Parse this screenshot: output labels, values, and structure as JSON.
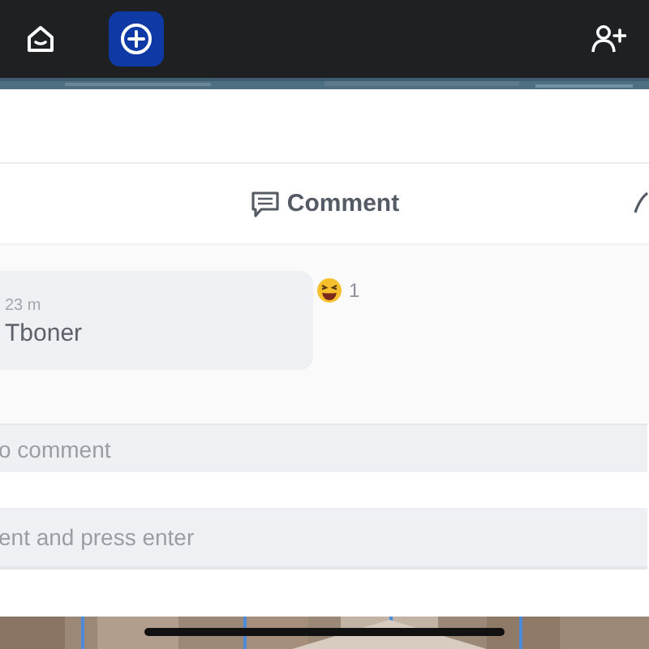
{
  "top_bar": {
    "buttons": [
      {
        "kind": "inbox",
        "selected": false
      },
      {
        "kind": "add",
        "selected": true
      },
      {
        "kind": "add-person",
        "selected": false
      }
    ]
  },
  "action_bar": {
    "comment_label": "Comment"
  },
  "comment": {
    "time": "23 m",
    "text": "Tboner",
    "reaction_count": "1"
  },
  "fields": [
    {
      "placeholder": "o comment"
    },
    {
      "placeholder": "ent and press enter"
    }
  ]
}
